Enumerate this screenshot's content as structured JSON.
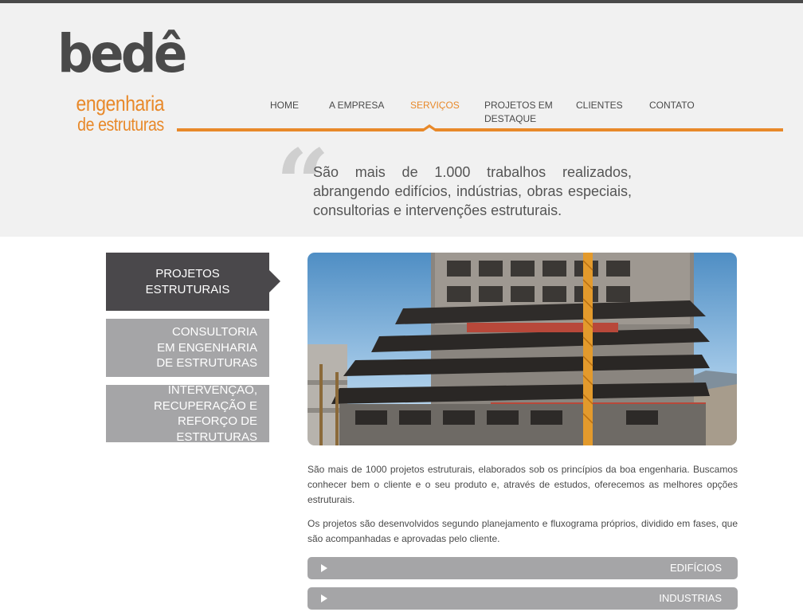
{
  "logo": {
    "main": "bedê",
    "line1": "engenharia",
    "line2": "de estruturas"
  },
  "nav": {
    "items": [
      {
        "label": "HOME"
      },
      {
        "label": "A EMPRESA"
      },
      {
        "label": "SERVIÇOS",
        "active": true
      },
      {
        "label": "PROJETOS EM DESTAQUE"
      },
      {
        "label": "CLIENTES"
      },
      {
        "label": "CONTATO"
      }
    ]
  },
  "quote": {
    "mark": "“",
    "text": "São mais de 1.000 trabalhos realizados, abrangendo edifícios, indústrias, obras especiais, consultorias e intervenções estruturais."
  },
  "side_menu": {
    "items": [
      {
        "label": "PROJETOS ESTRUTURAIS",
        "active": true
      },
      {
        "label": "CONSULTORIA EM ENGENHARIA DE ESTRUTURAS"
      },
      {
        "label": "INTERVENÇÃO, RECUPERAÇÃO E REFORÇO DE ESTRUTURAS"
      }
    ]
  },
  "content": {
    "paragraph1": "São mais de 1000 projetos estruturais, elaborados sob os princípios da boa engenharia. Buscamos conhecer bem o cliente e o seu produto e, através de estudos, oferecemos as melhores opções estruturais.",
    "paragraph2": "Os projetos são desenvolvidos segundo planejamento e fluxograma próprios, dividido em fases, que são acompanhadas e aprovadas pelo cliente."
  },
  "accordion": {
    "items": [
      {
        "label": "EDIFÍCIOS"
      },
      {
        "label": "INDUSTRIAS"
      }
    ]
  },
  "colors": {
    "accent": "#e8892a",
    "dark": "#4a484b",
    "gray": "#a5a5a7",
    "header_bg": "#f1f1f1"
  }
}
